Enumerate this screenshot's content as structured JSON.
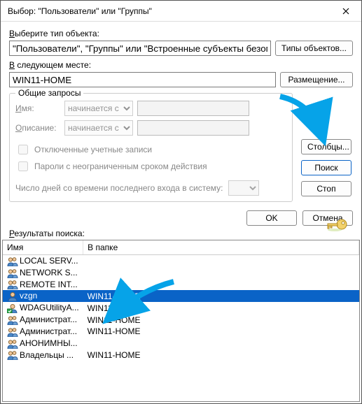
{
  "title": "Выбор: \"Пользователи\" или \"Группы\"",
  "section1_label": "Выберите тип объекта:",
  "object_types_value": "\"Пользователи\", \"Группы\" или \"Встроенные субъекты безопасности\"",
  "btn_object_types": "Типы объектов...",
  "section2_label": "В следующем месте:",
  "location_value": "WIN11-HOME",
  "btn_location": "Размещение...",
  "fieldset_title": "Общие запросы",
  "filter_name_label": "Имя:",
  "filter_desc_label": "Описание:",
  "combo_starts_with": "начинается с",
  "chk_disabled_accounts": "Отключенные учетные записи",
  "chk_nonexp_pw": "Пароли с неограниченным сроком действия",
  "days_label": "Число дней со времени последнего входа в систему:",
  "btn_columns": "Столбцы...",
  "btn_search": "Поиск",
  "btn_stop": "Стоп",
  "btn_ok": "OK",
  "btn_cancel": "Отмена",
  "results_label": "Результаты поиска:",
  "col_name": "Имя",
  "col_folder": "В папке",
  "rows": [
    {
      "iconType": "group",
      "name": "LOCAL SERV...",
      "folder": ""
    },
    {
      "iconType": "group",
      "name": "NETWORK S...",
      "folder": ""
    },
    {
      "iconType": "group",
      "name": "REMOTE INT...",
      "folder": ""
    },
    {
      "iconType": "user",
      "name": "vzgn",
      "folder": "WIN11-HOME"
    },
    {
      "iconType": "user-badge",
      "name": "WDAGUtilityA...",
      "folder": "WIN11-HOME"
    },
    {
      "iconType": "group",
      "name": "Администрат...",
      "folder": "WIN11-HOME"
    },
    {
      "iconType": "group",
      "name": "Администрат...",
      "folder": "WIN11-HOME"
    },
    {
      "iconType": "group",
      "name": "АНОНИМНЫ...",
      "folder": ""
    },
    {
      "iconType": "group",
      "name": "Владельцы ...",
      "folder": "WIN11-HOME"
    }
  ],
  "selectedRowIndex": 3
}
